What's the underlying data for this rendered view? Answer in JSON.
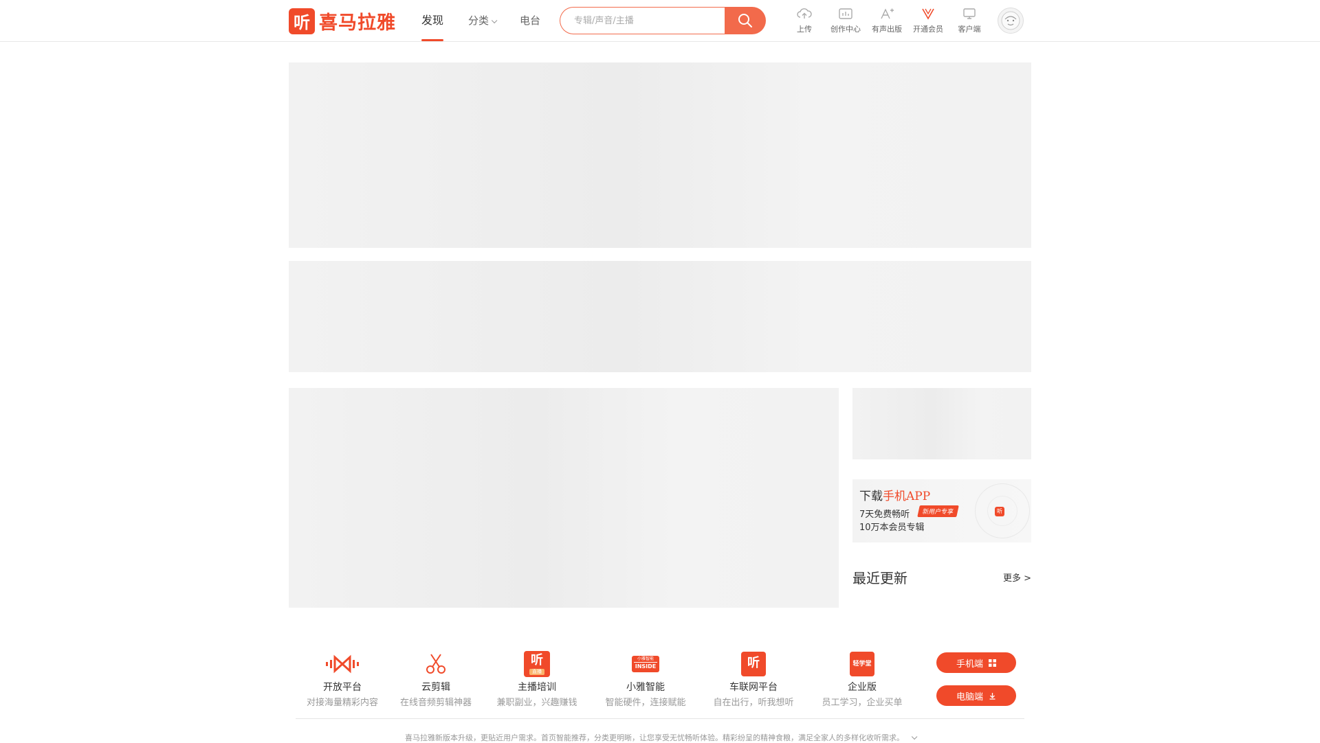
{
  "header": {
    "logo_mark": "听",
    "logo_text": "喜马拉雅",
    "nav": [
      {
        "label": "发现"
      },
      {
        "label": "分类"
      },
      {
        "label": "电台"
      }
    ],
    "search": {
      "placeholder": "专辑/声音/主播",
      "icon": "search-icon"
    },
    "tools": [
      {
        "label": "上传",
        "icon": "cloud-upload-icon"
      },
      {
        "label": "创作中心",
        "icon": "creator-center-icon"
      },
      {
        "label": "有声出版",
        "icon": "publish-icon"
      },
      {
        "label": "开通会员",
        "icon": "vip-icon"
      },
      {
        "label": "客户端",
        "icon": "monitor-icon"
      }
    ],
    "avatar_icon": "user-avatar-icon"
  },
  "sidebar": {
    "download": {
      "title_prefix": "下载",
      "title_highlight": "手机APP",
      "line1": "7天免费畅听",
      "line2": "10万本会员专辑",
      "badge": "新用户专享",
      "app_mark": "听"
    },
    "recent": {
      "title": "最近更新",
      "more": "更多 >"
    }
  },
  "footer": {
    "items": [
      {
        "title": "开放平台",
        "sub": "对接海量精彩内容",
        "icon": "open-platform-icon"
      },
      {
        "title": "云剪辑",
        "sub": "在线音频剪辑神器",
        "icon": "scissors-icon"
      },
      {
        "title": "主播培训",
        "sub": "兼职副业，兴趣赚钱",
        "icon": "anchor-training-icon",
        "icon_text": "听",
        "icon_small": "直播"
      },
      {
        "title": "小雅智能",
        "sub": "智能硬件，连接赋能",
        "icon": "xiaoya-inside-icon",
        "icon_text": "INSIDE",
        "icon_small": "小雅智能"
      },
      {
        "title": "车联网平台",
        "sub": "自在出行，听我想听",
        "icon": "car-platform-icon",
        "icon_text": "听"
      },
      {
        "title": "企业版",
        "sub": "员工学习，企业买单",
        "icon": "enterprise-icon",
        "icon_text": "轻学堂"
      }
    ],
    "buttons": [
      {
        "label": "手机端",
        "icon": "qrcode-icon"
      },
      {
        "label": "电脑端",
        "icon": "download-icon"
      }
    ],
    "notice": "喜马拉雅新版本升级，更贴近用户需求。首页智能推荐，分类更明晰，让您享受无忧畅听体验。精彩纷呈的精神食粮，满足全家人的多样化收听需求。"
  },
  "colors": {
    "brand": "#f04a2a",
    "search_btn": "#f26a4b",
    "skeleton": "#f2f2f2"
  }
}
